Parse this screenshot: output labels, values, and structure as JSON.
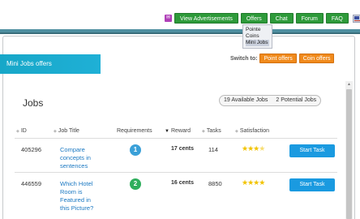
{
  "nav": {
    "badge": "✉",
    "items": [
      "View Advertisements",
      "Offers",
      "Chat",
      "Forum",
      "FAQ"
    ],
    "flag": "flag-icon"
  },
  "dropdown": {
    "items": [
      "Pointe",
      "Coins",
      "Mini Jobs"
    ],
    "selected": "Mini Jobs"
  },
  "banner": {
    "title": "Mini Jobs offers"
  },
  "switch": {
    "label": "Switch to:",
    "point_offers": "Point offers",
    "coin_offers": "Coin offers"
  },
  "page_title": "Jobs",
  "counts": {
    "available": "19 Available Jobs",
    "potential": "2 Potential Jobs"
  },
  "table": {
    "headers": [
      "ID",
      "Job Title",
      "Requirements",
      "Reward",
      "Tasks",
      "Satisfaction"
    ],
    "sorted_column": "Reward",
    "rows": [
      {
        "id": "405296",
        "title_lines": [
          "Compare",
          "concepts in",
          "sentences"
        ],
        "requirement": "1",
        "requirement_color": "#3aa0d8",
        "reward": "17 cents",
        "tasks": "114",
        "stars_filled": 3,
        "stars_partial": true,
        "button": "Start Task"
      },
      {
        "id": "446559",
        "title_lines": [
          "Which Hotel",
          "Room is",
          "Featured in",
          "this Picture?"
        ],
        "requirement": "2",
        "requirement_color": "#2fae5c",
        "reward": "16 cents",
        "tasks": "8850",
        "stars_filled": 4,
        "stars_partial": false,
        "button": "Start Task"
      }
    ]
  }
}
